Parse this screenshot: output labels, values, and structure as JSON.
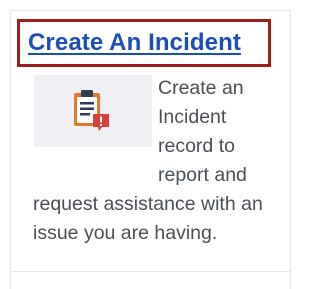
{
  "card": {
    "title": "Create An Incident",
    "description": "Create an Incident record to report and request assistance with an issue you are having.",
    "icon": "clipboard-alert-icon",
    "colors": {
      "title_link": "#1b4fb6",
      "highlight_border": "#9e1e1e",
      "body_text": "#4a4f55",
      "thumbnail_bg": "#eef0f3"
    }
  }
}
